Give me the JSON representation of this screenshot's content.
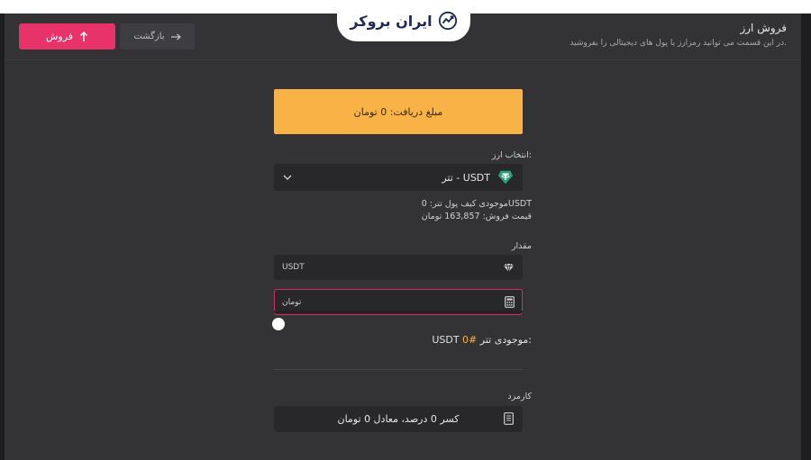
{
  "header": {
    "title": "فروش ارز",
    "subtitle": "در این قسمت می توانید رمزارز یا پول های دیجیتالی را بفروشید.",
    "sell_button_label": "فروش",
    "back_button_label": "بازگشت"
  },
  "logo": {
    "text": "ایران بروکر",
    "icon": "chart-trend-icon"
  },
  "form": {
    "received_amount": "مبلغ دریافت: 0 تومان",
    "currency_label": "انتخاب ارز:",
    "selected_currency": "تتر - USDT",
    "wallet_balance": "موجودی کیف پول تتر: 0USDT",
    "sell_price": "قیمت فروش: 163,857 تومان",
    "amount_label": "مقدار",
    "usdt_placeholder": "USDT",
    "toman_placeholder": "تومان",
    "slider_value": 0,
    "balance_prefix": "موجودی تتر:",
    "balance_value": "0#",
    "balance_unit": "USDT",
    "fee_label": "کارمزد",
    "fee_text": "کسر 0 درصد، معادل 0 تومان"
  },
  "colors": {
    "accent_pink": "#e8336a",
    "accent_orange": "#f9b246",
    "tether_green": "#26a17b",
    "panel_bg": "#333335"
  }
}
